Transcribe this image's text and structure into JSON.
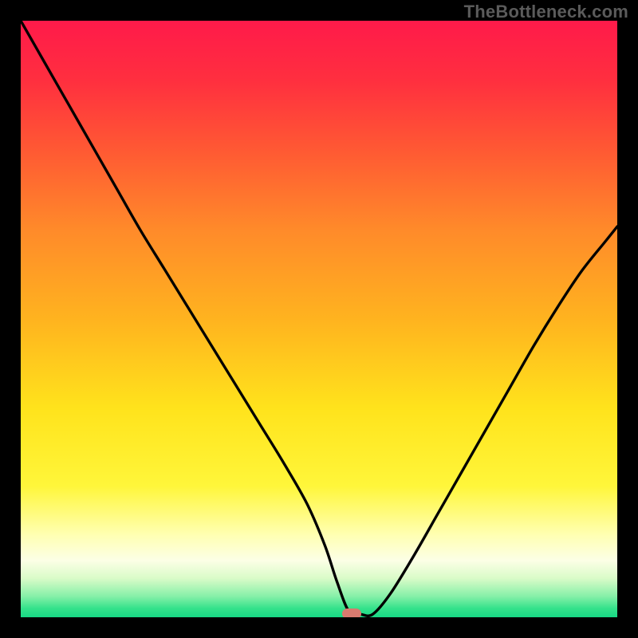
{
  "watermark": "TheBottleneck.com",
  "colors": {
    "frame": "#000000",
    "marker": "#d97a6f",
    "gradient_stops": [
      {
        "offset": 0.0,
        "color": "#ff1a4a"
      },
      {
        "offset": 0.1,
        "color": "#ff2f3f"
      },
      {
        "offset": 0.22,
        "color": "#ff5a33"
      },
      {
        "offset": 0.35,
        "color": "#ff8a2a"
      },
      {
        "offset": 0.5,
        "color": "#ffb31f"
      },
      {
        "offset": 0.65,
        "color": "#ffe31c"
      },
      {
        "offset": 0.78,
        "color": "#fff63a"
      },
      {
        "offset": 0.86,
        "color": "#ffffb0"
      },
      {
        "offset": 0.905,
        "color": "#fcffe6"
      },
      {
        "offset": 0.935,
        "color": "#d9fbc8"
      },
      {
        "offset": 0.965,
        "color": "#86f0a8"
      },
      {
        "offset": 0.985,
        "color": "#35e28b"
      },
      {
        "offset": 1.0,
        "color": "#17d985"
      }
    ]
  },
  "chart_data": {
    "type": "line",
    "title": "",
    "xlabel": "",
    "ylabel": "",
    "xlim": [
      0,
      100
    ],
    "ylim": [
      0,
      100
    ],
    "grid": false,
    "legend": false,
    "marker": {
      "x": 55.5,
      "y": 0.6,
      "w_pct": 3.2,
      "h_pct": 1.7
    },
    "series": [
      {
        "name": "bottleneck-curve",
        "x": [
          0,
          4,
          8,
          12,
          16,
          20,
          24,
          28,
          32,
          36,
          40,
          44,
          48,
          51,
          53,
          55,
          57,
          59,
          62,
          66,
          70,
          74,
          78,
          82,
          86,
          90,
          94,
          98,
          100
        ],
        "y": [
          100,
          93,
          86,
          79,
          72,
          65,
          58.5,
          52,
          45.5,
          39,
          32.5,
          26,
          19,
          12,
          6,
          1,
          0.5,
          0.5,
          4,
          10.5,
          17.5,
          24.5,
          31.5,
          38.5,
          45.5,
          52,
          58,
          63,
          65.5
        ]
      }
    ]
  }
}
